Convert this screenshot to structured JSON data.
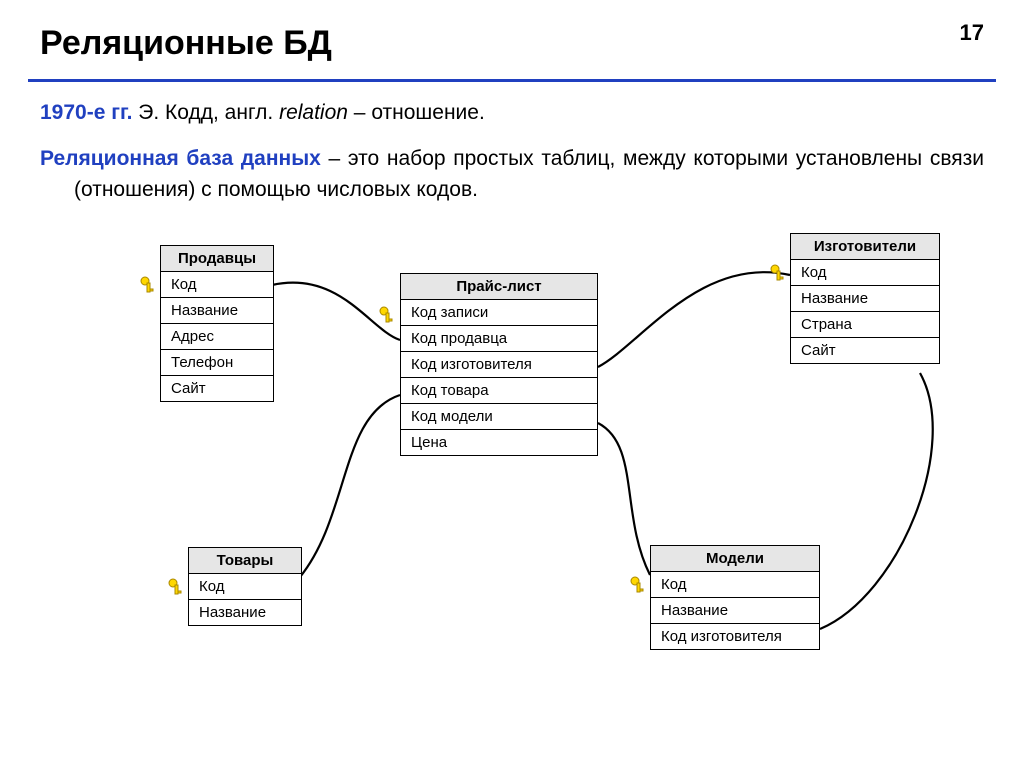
{
  "pageNumber": "17",
  "title": "Реляционные БД",
  "line1": {
    "lead": "1970-е гг.",
    "rest1": " Э. Кодд, англ. ",
    "italic": "relation",
    "rest2": " – отношение."
  },
  "line2": {
    "term": "Реляционная база данных",
    "def": " – это набор простых таблиц, между которыми установлены связи (отношения) с помощью числовых кодов."
  },
  "tables": {
    "sellers": {
      "title": "Продавцы",
      "rows": [
        "Код",
        "Название",
        "Адрес",
        "Телефон",
        "Сайт"
      ]
    },
    "pricelist": {
      "title": "Прайс-лист",
      "rows": [
        "Код записи",
        "Код продавца",
        "Код изготовителя",
        "Код товара",
        "Код модели",
        "Цена"
      ]
    },
    "manufacturers": {
      "title": "Изготовители",
      "rows": [
        "Код",
        "Название",
        "Страна",
        "Сайт"
      ]
    },
    "goods": {
      "title": "Товары",
      "rows": [
        "Код",
        "Название"
      ]
    },
    "models": {
      "title": "Модели",
      "rows": [
        "Код",
        "Название",
        "Код изготовителя"
      ]
    }
  },
  "icons": {
    "key": "key-icon"
  }
}
